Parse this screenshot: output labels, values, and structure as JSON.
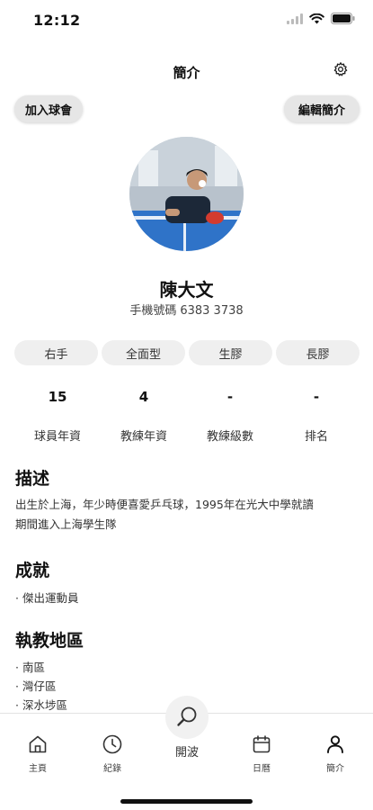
{
  "status_bar": {
    "time": "12:12"
  },
  "header": {
    "title": "簡介"
  },
  "buttons": {
    "join_club": "加入球會",
    "edit_profile": "編輯簡介"
  },
  "profile": {
    "name": "陳大文",
    "phone_label": "手機號碼",
    "phone_number": "6383 3738"
  },
  "tags": [
    "右手",
    "全面型",
    "生膠",
    "長膠"
  ],
  "stats": [
    {
      "value": "15",
      "label": "球員年資"
    },
    {
      "value": "4",
      "label": "教練年資"
    },
    {
      "value": "-",
      "label": "教練級數"
    },
    {
      "value": "-",
      "label": "排名"
    }
  ],
  "description": {
    "title": "描述",
    "line1": "出生於上海，年少時便喜愛乒乓球，1995年在光大中學就讀",
    "line2": "期間進入上海學生隊"
  },
  "achievements": {
    "title": "成就",
    "items": [
      "· 傑出運動員"
    ]
  },
  "areas": {
    "title": "執教地區",
    "items": [
      "· 南區",
      "· 灣仔區",
      "· 深水埗區"
    ]
  },
  "tabbar": {
    "home": "主頁",
    "records": "紀錄",
    "center": "開波",
    "calendar": "日曆",
    "profile": "簡介"
  }
}
